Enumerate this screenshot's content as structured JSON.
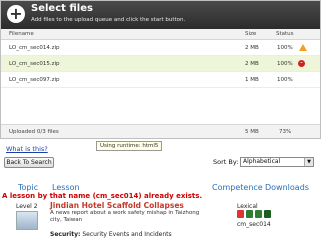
{
  "uploader": {
    "title": "Select files",
    "subtitle": "Add files to the upload queue and click the start button.",
    "columns": {
      "filename": "Filename",
      "size": "Size",
      "status": "Status"
    },
    "files": [
      {
        "name": "LO_cm_sec014.zip",
        "size": "2 MB",
        "status": "100%",
        "icon": "warning-icon"
      },
      {
        "name": "LO_cm_sec015.zip",
        "size": "2 MB",
        "status": "100%",
        "icon": "delete-icon"
      },
      {
        "name": "LO_cm_sec097.zip",
        "size": "1 MB",
        "status": "100%",
        "icon": ""
      }
    ],
    "footer": {
      "uploaded": "Uploaded 0/3 files",
      "total_size": "5 MB",
      "total_status": "73%"
    },
    "tooltip": "Using runtime: html5"
  },
  "what_link": "What is this?",
  "back_button": "Back To Search",
  "sort": {
    "label": "Sort By:",
    "selected": "Alphabetical"
  },
  "results_header": {
    "topic": "Topic",
    "lesson": "Lesson",
    "competence": "Competence",
    "downloads": "Downloads"
  },
  "error_message": "A lesson by that name (cm_sec014) already exists.",
  "lesson": {
    "level": "Level 2",
    "title": "Jindian Hotel Scaffold Collapses",
    "description": "A news report about a work safety mishap in Taizhong city, Taiwan",
    "security_label": "Security:",
    "security_value": "Security Events and Incidents",
    "competence": "Lexical",
    "code": "cm_sec014",
    "download_icons": [
      {
        "name": "pdf-icon",
        "color": "#d33"
      },
      {
        "name": "doc-icon",
        "color": "#2e7d32"
      },
      {
        "name": "audio-icon",
        "color": "#2e7d32"
      },
      {
        "name": "web-icon",
        "color": "#1b5e20"
      }
    ]
  }
}
